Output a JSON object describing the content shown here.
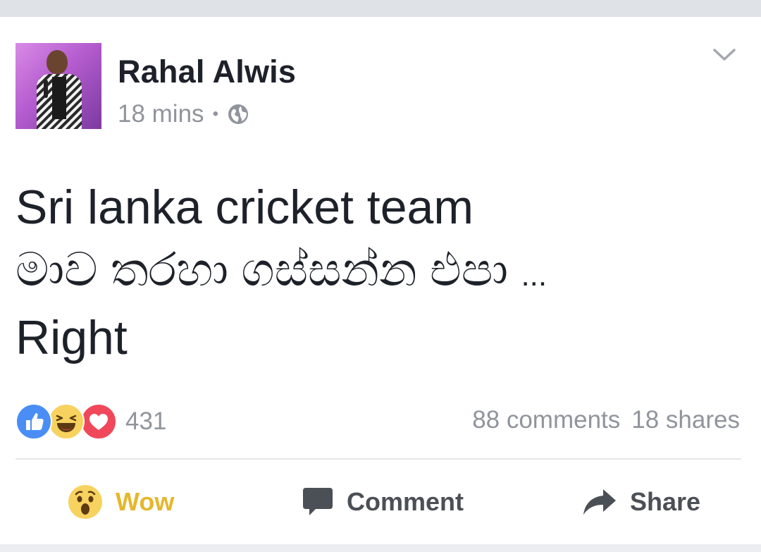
{
  "post": {
    "author": "Rahal Alwis",
    "time": "18 mins",
    "separator": "•",
    "lines": [
      "Sri lanka cricket team",
      "මාව තරහා ගස්සන්න එපා",
      "Right"
    ],
    "ellipsis": "..."
  },
  "stats": {
    "reaction_count": "431",
    "comments": "88 comments",
    "shares": "18 shares"
  },
  "actions": {
    "wow": "Wow",
    "comment": "Comment",
    "share": "Share"
  },
  "icons": [
    "globe-icon",
    "chevron-down-icon",
    "like-reaction-icon",
    "haha-reaction-icon",
    "love-reaction-icon",
    "wow-icon",
    "comment-icon",
    "share-icon"
  ],
  "colors": {
    "accent_wow": "#e5b72e",
    "like_blue": "#4a8ef5",
    "love_red": "#f0485a",
    "haha_yellow": "#f7d25f",
    "text_primary": "#1d2129",
    "text_secondary": "#90949c"
  }
}
